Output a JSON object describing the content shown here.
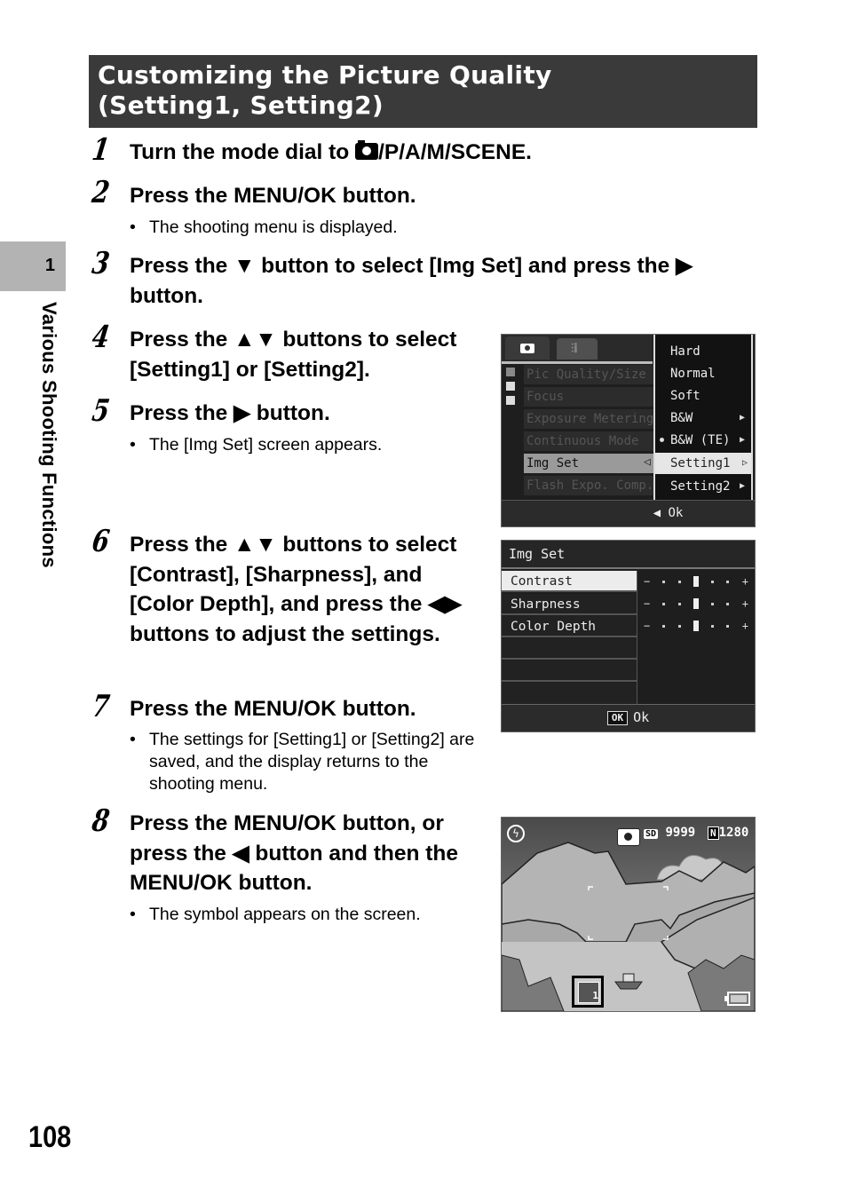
{
  "header": {
    "title": "Customizing the Picture Quality\n(Setting1, Setting2)"
  },
  "side_tab": {
    "chapter_number": "1",
    "chapter_label": "Various Shooting Functions"
  },
  "page_number": "108",
  "steps": [
    {
      "number": "1",
      "text": "Turn the mode dial to ◘/P/A/M/SCENE.",
      "text_before_icon": "Turn the mode dial to ",
      "icon": "camera-icon",
      "text_after_icon": "/P/A/M/SCENE."
    },
    {
      "number": "2",
      "text": "Press the MENU/OK button.",
      "bullets": [
        "The shooting menu is displayed."
      ]
    },
    {
      "number": "3",
      "text": "Press the ▼ button to select [Img Set] and press the ▶ button."
    },
    {
      "number": "4",
      "text": "Press the ▲▼ buttons to select [Setting1] or [Setting2]."
    },
    {
      "number": "5",
      "text": "Press the ▶ button.",
      "bullets": [
        "The [Img Set] screen appears."
      ]
    },
    {
      "number": "6",
      "text": "Press the ▲▼ buttons to select [Contrast], [Sharpness], and [Color Depth], and press the ◀▶ buttons to adjust the settings."
    },
    {
      "number": "7",
      "text": "Press the MENU/OK button.",
      "bullets": [
        "The settings for [Setting1] or [Setting2] are saved, and the display returns to the shooting menu."
      ]
    },
    {
      "number": "8",
      "text": "Press the MENU/OK button, or press the ◀ button and then the MENU/OK button.",
      "bullets": [
        "The symbol appears on the screen."
      ]
    }
  ],
  "screen_menu": {
    "tabs": [
      "camera-icon",
      "setup-icon"
    ],
    "items": [
      "Pic Quality/Size",
      "Focus",
      "Exposure Metering",
      "Continuous Mode",
      "Img Set",
      "Flash Expo. Comp."
    ],
    "selected_item": "Img Set",
    "submenu": [
      {
        "label": "Hard",
        "arrow": ""
      },
      {
        "label": "Normal",
        "arrow": ""
      },
      {
        "label": "Soft",
        "arrow": ""
      },
      {
        "label": "B&W",
        "arrow": "▶"
      },
      {
        "label": "B&W (TE)",
        "arrow": "▶",
        "current": true
      },
      {
        "label": "Setting1",
        "arrow": "▷",
        "selected": true
      },
      {
        "label": "Setting2",
        "arrow": "▶"
      }
    ],
    "back_arrow": "◁",
    "footer": "◀ Ok"
  },
  "screen_imgset": {
    "title": "Img Set",
    "rows": [
      {
        "label": "Contrast",
        "value": 0,
        "selected": true
      },
      {
        "label": "Sharpness",
        "value": 0
      },
      {
        "label": "Color Depth",
        "value": 0
      }
    ],
    "scale_min_label": "−",
    "scale_max_label": "+",
    "footer_key": "OK",
    "footer": "Ok"
  },
  "screen_shooting": {
    "flash_icon": "flash-off-icon",
    "media": "SD",
    "remaining_shots": "9999",
    "quality": "N",
    "size": "1280",
    "setting_symbol": "img-setting1-icon",
    "battery_icon": "battery-icon"
  }
}
